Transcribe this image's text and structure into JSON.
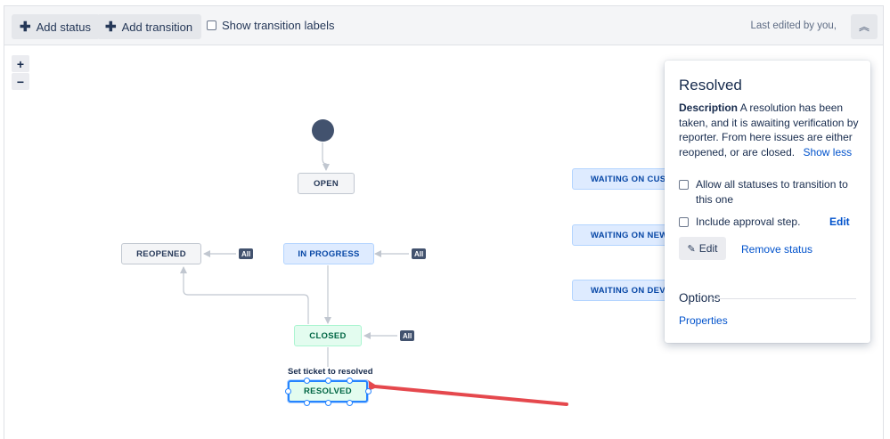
{
  "toolbar": {
    "add_status": "Add status",
    "add_transition": "Add transition",
    "show_transition_labels": "Show transition labels",
    "last_edited": "Last edited by you,"
  },
  "zoom": {
    "in": "+",
    "out": "−"
  },
  "diagram": {
    "statuses": {
      "open": "OPEN",
      "reopened": "REOPENED",
      "in_progress": "IN PROGRESS",
      "closed": "CLOSED",
      "resolved": "RESOLVED",
      "waiting_on_customer": "WAITING ON CUSTO",
      "waiting_on_new": "WAITING ON NEW V",
      "waiting_on_dev": "WAITING ON DEV"
    },
    "all_label": "All",
    "transition_label": "Set ticket to resolved",
    "colors": {
      "todo": "#f4f5f7",
      "in_progress": "#deebff",
      "done": "#e3fcef",
      "selection": "#2684ff",
      "annotation_arrow": "#e5484d"
    }
  },
  "panel": {
    "title": "Resolved",
    "description_label": "Description",
    "description": "A resolution has been taken, and it is awaiting verification by reporter. From here issues are either reopened, or are closed.",
    "show_less": "Show less",
    "allow_all": "Allow all statuses to transition to this one",
    "include_approval": "Include approval step.",
    "edit_link": "Edit",
    "edit_button": "Edit",
    "remove_status": "Remove status",
    "options_heading": "Options",
    "properties": "Properties"
  }
}
